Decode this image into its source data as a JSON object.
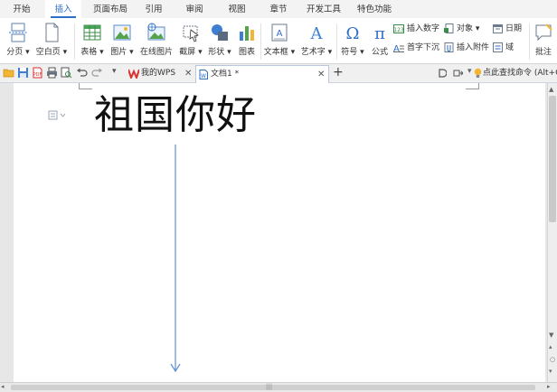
{
  "tabs": [
    "开始",
    "插入",
    "页面布局",
    "引用",
    "审阅",
    "视图",
    "章节",
    "开发工具",
    "特色功能"
  ],
  "active_tab": "插入",
  "ribbon": {
    "page_break": "分页",
    "blank_page": "空白页",
    "table": "表格",
    "picture": "图片",
    "online_picture": "在线图片",
    "screenshot": "截屏",
    "shape": "形状",
    "chart": "图表",
    "text_box": "文本框",
    "word_art": "艺术字",
    "symbol": "符号",
    "formula": "公式",
    "insert_number": "插入数字",
    "object": "对象",
    "date": "日期",
    "drop_cap": "首字下沉",
    "attachment": "插入附件",
    "field": "域",
    "comment": "批注"
  },
  "quickbar": {
    "wps_tab": "我的WPS",
    "doc_tab": "文档1 *",
    "add": "+",
    "search_hint": "点此查找命令 (Alt+Q"
  },
  "document": {
    "heading": "祖国你好"
  },
  "colors": {
    "accent": "#2d6fc7",
    "wps_red": "#d9302c",
    "arrow": "#5b8fd6"
  },
  "icons": {
    "file": "folder-icon",
    "save": "save-icon",
    "pdf": "export-pdf-icon",
    "print": "print-icon",
    "preview": "print-preview-icon",
    "undo": "undo-icon",
    "redo": "redo-icon"
  }
}
